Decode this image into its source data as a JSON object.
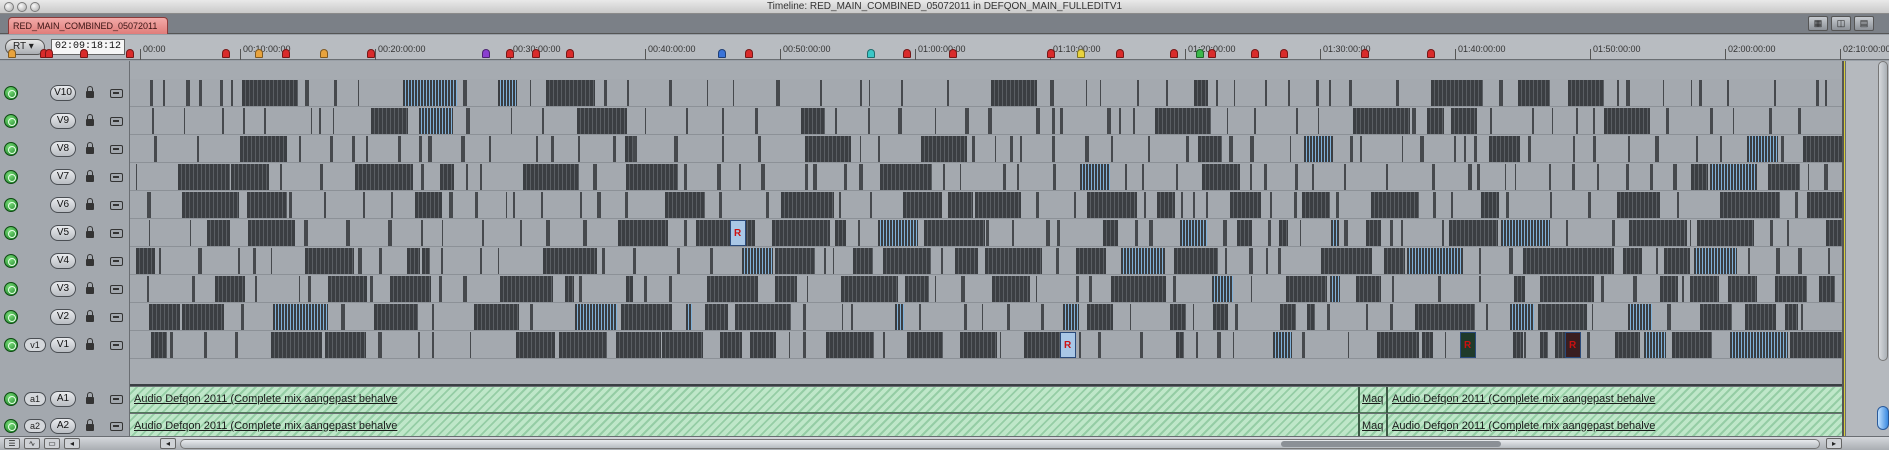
{
  "window": {
    "title": "Timeline: RED_MAIN_COMBINED_05072011 in DEFQON_MAIN_FULLEDITV1"
  },
  "tab": {
    "label": "RED_MAIN_COMBINED_05072011"
  },
  "toolbar": {
    "rt_label": "RT ▾",
    "timecode": "02:09:18:12"
  },
  "ruler": {
    "labels": [
      "00:00",
      "00:10:00:00",
      "00:20:00:00",
      "00:30:00:00",
      "00:40:00:00",
      "00:50:00:00",
      "01:00:00:00",
      "01:10:00:00",
      "01:20:00:00",
      "01:30:00:00",
      "01:40:00:00",
      "01:50:00:00",
      "02:00:00:00",
      "02:10:00:00"
    ],
    "markers": [
      {
        "color": "#e8a33d"
      },
      {
        "color": "#d92b2b"
      },
      {
        "color": "#d92b2b"
      },
      {
        "color": "#d92b2b"
      },
      {
        "color": "#d92b2b"
      },
      {
        "color": "#d92b2b"
      },
      {
        "color": "#e8a33d"
      },
      {
        "color": "#d92b2b"
      },
      {
        "color": "#e8a33d"
      },
      {
        "color": "#d92b2b"
      },
      {
        "color": "#8a3fd0"
      },
      {
        "color": "#d92b2b"
      },
      {
        "color": "#d92b2b"
      },
      {
        "color": "#d92b2b"
      },
      {
        "color": "#3a73d8"
      },
      {
        "color": "#d92b2b"
      },
      {
        "color": "#3ac7c7"
      },
      {
        "color": "#d92b2b"
      },
      {
        "color": "#d92b2b"
      },
      {
        "color": "#d92b2b"
      },
      {
        "color": "#e8d23d"
      },
      {
        "color": "#d92b2b"
      },
      {
        "color": "#d92b2b"
      },
      {
        "color": "#3ab84a"
      },
      {
        "color": "#d92b2b"
      },
      {
        "color": "#d92b2b"
      },
      {
        "color": "#d92b2b"
      },
      {
        "color": "#d92b2b"
      },
      {
        "color": "#d92b2b"
      }
    ]
  },
  "video_tracks": [
    {
      "label": "V10",
      "source": ""
    },
    {
      "label": "V9",
      "source": ""
    },
    {
      "label": "V8",
      "source": ""
    },
    {
      "label": "V7",
      "source": ""
    },
    {
      "label": "V6",
      "source": ""
    },
    {
      "label": "V5",
      "source": ""
    },
    {
      "label": "V4",
      "source": ""
    },
    {
      "label": "V3",
      "source": ""
    },
    {
      "label": "V2",
      "source": ""
    },
    {
      "label": "V1",
      "source": "v1"
    }
  ],
  "audio_tracks": [
    {
      "label": "A1",
      "source": "a1"
    },
    {
      "label": "A2",
      "source": "a2"
    }
  ],
  "audio_clips": {
    "clip1": "Audio Defqon 2011 (Complete mix aangepast behalve",
    "clip_mid": "Maq",
    "clip2": "Audio Defqon 2011 (Complete mix aangepast behalve"
  },
  "clip_labels": {
    "v5_clip": "R",
    "v1_clip": "R",
    "v1_red_a": "R",
    "v1_red_b": "R"
  }
}
